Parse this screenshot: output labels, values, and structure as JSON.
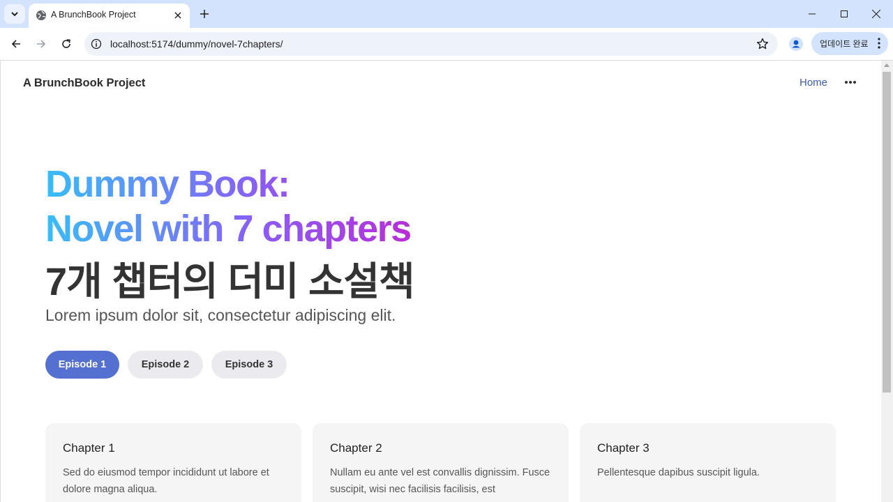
{
  "browser": {
    "tab_title": "A BrunchBook Project",
    "url": "localhost:5174/dummy/novel-7chapters/",
    "update_label": "업데이트 완료"
  },
  "site": {
    "title": "A BrunchBook Project",
    "nav_home": "Home"
  },
  "hero": {
    "line1": "Dummy Book:",
    "line2": "Novel with 7 chapters",
    "line3": "7개 챕터의 더미 소설책",
    "subtitle": "Lorem ipsum dolor sit, consectetur adipiscing elit."
  },
  "episodes": [
    {
      "label": "Episode 1",
      "active": true
    },
    {
      "label": "Episode 2",
      "active": false
    },
    {
      "label": "Episode 3",
      "active": false
    }
  ],
  "chapters": [
    {
      "title": "Chapter 1",
      "text": "Sed do eiusmod tempor incididunt ut labore et dolore magna aliqua."
    },
    {
      "title": "Chapter 2",
      "text": "Nullam eu ante vel est convallis dignissim. Fusce suscipit, wisi nec facilisis facilisis, est"
    },
    {
      "title": "Chapter 3",
      "text": "Pellentesque dapibus suscipit ligula."
    }
  ],
  "colors": {
    "accent": "#5470d0",
    "gradient_start": "#38bdf8",
    "gradient_end": "#c026d3",
    "chrome_tabstrip": "#d3e3fd"
  },
  "icons": [
    "tab-search-icon",
    "globe-icon",
    "close-icon",
    "plus-icon",
    "minimize-icon",
    "maximize-icon",
    "window-close-icon",
    "back-arrow-icon",
    "forward-arrow-icon",
    "reload-icon",
    "info-icon",
    "star-icon",
    "profile-icon",
    "kebab-menu-icon",
    "more-horizontal-icon"
  ]
}
